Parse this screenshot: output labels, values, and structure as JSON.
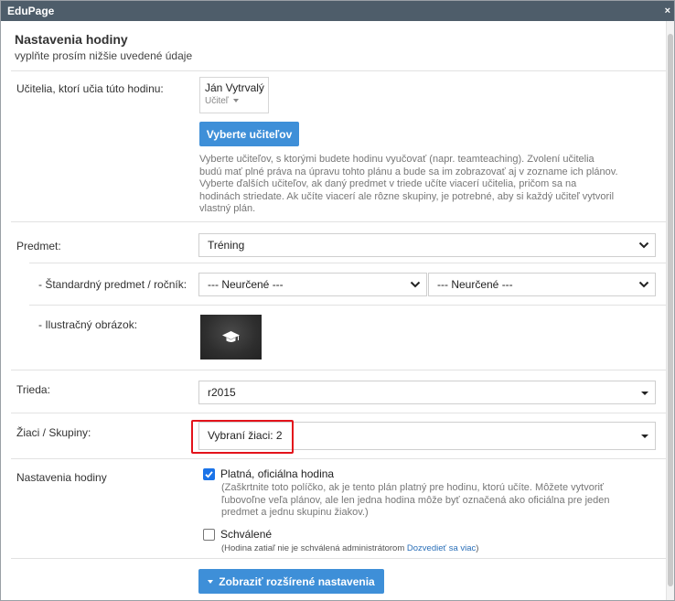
{
  "window": {
    "title": "EduPage",
    "close_glyph": "×"
  },
  "header": {
    "title": "Nastavenia hodiny",
    "subtitle": "vyplňte prosím nižšie uvedené údaje"
  },
  "teachers": {
    "label": "Učitelia, ktorí učia túto hodinu:",
    "selected_name": "Ján Vytrvalý",
    "selected_role": "Učiteľ",
    "select_button": "Vyberte učiteľov",
    "help_lines": [
      "Vyberte učiteľov, s ktorými budete hodinu vyučovať (napr. teamteaching). Zvolení učitelia",
      "budú mať plné práva na úpravu tohto plánu a bude sa im zobrazovať aj v zozname ich plánov.",
      "Vyberte ďalších učiteľov, ak daný predmet v triede učíte viacerí učitelia, pričom sa na",
      "hodinách striedate. Ak učíte viacerí ale rôzne skupiny, je potrebné, aby si každý učiteľ vytvoril",
      "vlastný plán."
    ]
  },
  "subject": {
    "label": "Predmet:",
    "value": "Tréning"
  },
  "standard": {
    "label": "- Štandardný predmet / ročník:",
    "subject_value": "--- Neurčené ---",
    "grade_value": "--- Neurčené ---"
  },
  "illustration": {
    "label": "- Ilustračný obrázok:",
    "icon": "graduation-cap-icon"
  },
  "class": {
    "label": "Trieda:",
    "value": "r2015"
  },
  "students": {
    "label": "Žiaci / Skupiny:",
    "value": "Vybraní žiaci: 2"
  },
  "lesson_settings": {
    "label": "Nastavenia hodiny",
    "official": {
      "label": "Platná, oficiálna hodina",
      "checked": true,
      "help_lines": [
        "(Zaškrtnite toto políčko, ak je tento plán platný pre hodinu, ktorú učíte. Môžete vytvoriť",
        "ľubovoľne veľa plánov, ale len jedna hodina môže byť označená ako oficiálna pre jeden",
        "predmet a jednu skupinu žiakov.)"
      ]
    },
    "approved": {
      "label": "Schválené",
      "checked": false,
      "note": "(Hodina zatiaľ nie je schválená administrátorom",
      "link": "Dozvedieť sa viac",
      "note_end": ")"
    }
  },
  "advanced_button": "Zobraziť rozšírené nastavenia",
  "colors": {
    "accent": "#3e8fd8",
    "highlight": "#e3131b",
    "titlebar": "#4e5d6a"
  }
}
